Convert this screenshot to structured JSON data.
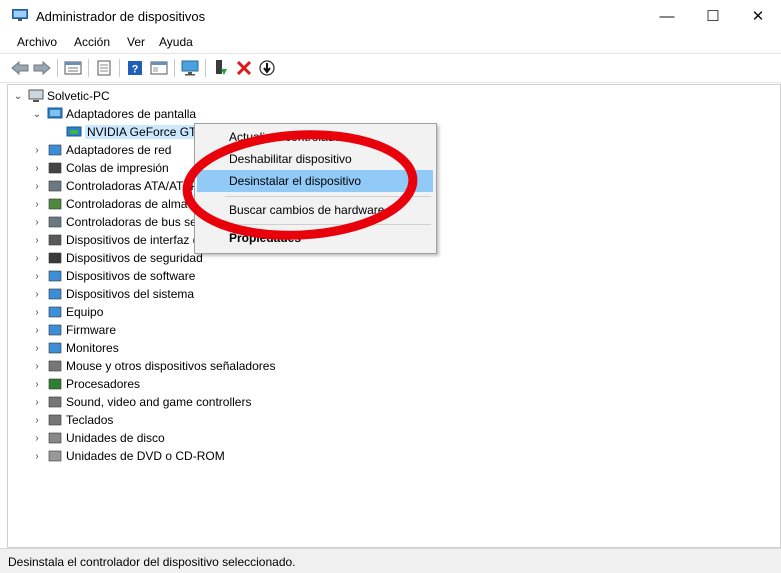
{
  "window": {
    "title": "Administrador de dispositivos",
    "controls": {
      "minimize": "—",
      "maximize": "☐",
      "close": "✕"
    }
  },
  "menu": [
    "Archivo",
    "Acción",
    "Ver",
    "Ayuda"
  ],
  "toolbar": {
    "icons": [
      "back-icon",
      "forward-icon",
      "properties-view-icon",
      "document-icon",
      "help-icon",
      "panel-icon",
      "monitor-icon",
      "enable-device-icon",
      "uninstall-icon",
      "update-driver-icon"
    ]
  },
  "tree": {
    "root": "Solvetic-PC",
    "expanded_category": "Adaptadores de pantalla",
    "selected_device": "NVIDIA GeForce GTX",
    "categories": [
      "Adaptadores de red",
      "Colas de impresión",
      "Controladoras ATA/ATAPI",
      "Controladoras de almacenamiento",
      "Controladoras de bus serie universal",
      "Dispositivos de interfaz de usuario (HID)",
      "Dispositivos de seguridad",
      "Dispositivos de software",
      "Dispositivos del sistema",
      "Equipo",
      "Firmware",
      "Monitores",
      "Mouse y otros dispositivos señaladores",
      "Procesadores",
      "Sound, video and game controllers",
      "Teclados",
      "Unidades de disco",
      "Unidades de DVD o CD-ROM"
    ]
  },
  "context_menu": {
    "items": [
      "Actualizar controlador",
      "Deshabilitar dispositivo",
      "Desinstalar el dispositivo",
      "Buscar cambios de hardware",
      "Propiedades"
    ],
    "highlighted": "Desinstalar el dispositivo"
  },
  "status": "Desinstala el controlador del dispositivo seleccionado.",
  "colors": {
    "highlight": "#91c9f7",
    "annotation": "#e8000b",
    "selection": "#cce8ff"
  }
}
